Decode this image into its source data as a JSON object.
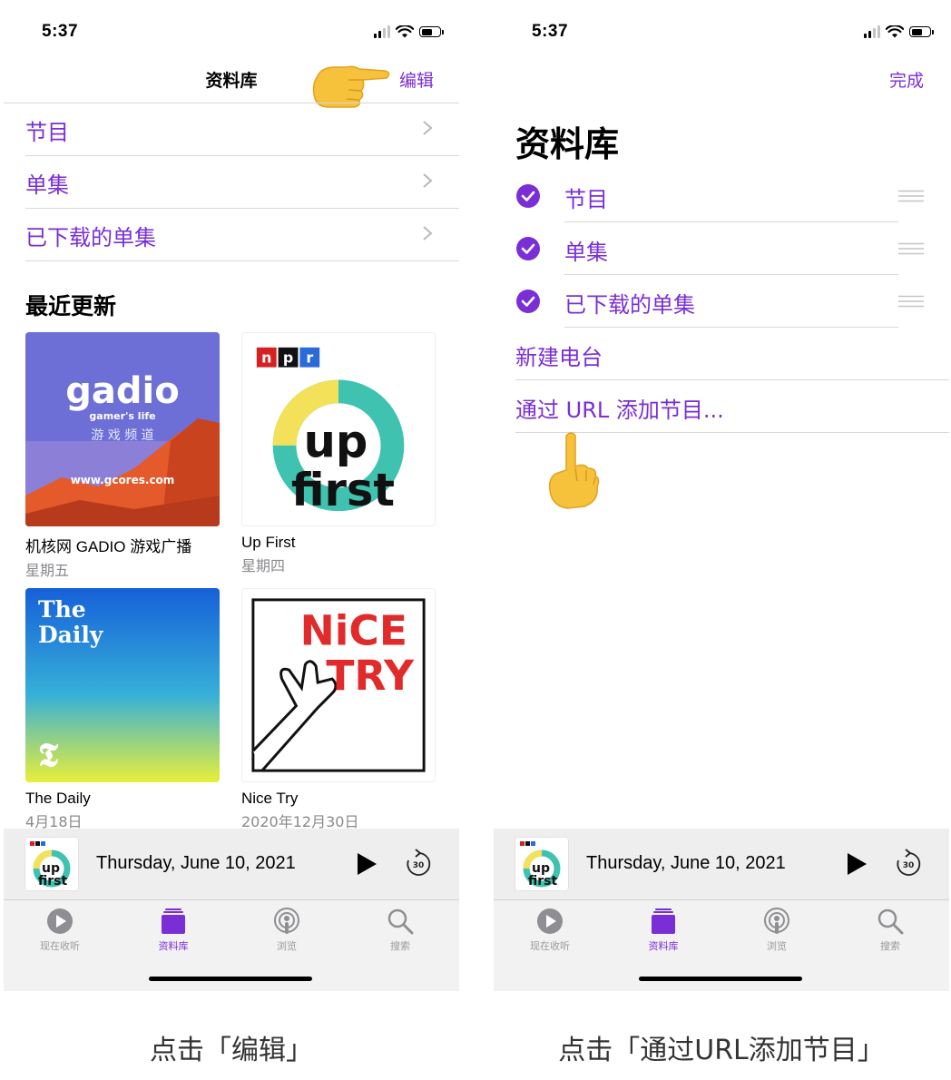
{
  "left": {
    "status": {
      "time": "5:37"
    },
    "nav": {
      "title": "资料库",
      "edit_label": "编辑"
    },
    "library_items": [
      {
        "label": "节目"
      },
      {
        "label": "单集"
      },
      {
        "label": "已下载的单集"
      }
    ],
    "recent": {
      "title": "最近更新",
      "tiles": [
        {
          "name": "机核网 GADIO 游戏广播",
          "date": "星期五",
          "art_text": [
            "gadio",
            "gamer's life",
            "游 戏 频 道",
            "www.gcores.com"
          ]
        },
        {
          "name": "Up First",
          "date": "星期四",
          "art_text": [
            "n",
            "p",
            "r",
            "up",
            "first"
          ]
        },
        {
          "name": "The Daily",
          "date": "4月18日",
          "art_text": [
            "The",
            "Daily"
          ]
        },
        {
          "name": "Nice Try",
          "date": "2020年12月30日",
          "art_text": [
            "NiCE",
            "TRY"
          ]
        }
      ]
    },
    "mini_player": {
      "episode": "Thursday, June 10, 2021",
      "skip_label": "30",
      "thumb_text": [
        "up",
        "first"
      ]
    },
    "tabs": [
      {
        "label": "现在收听",
        "icon": "play-circle-icon"
      },
      {
        "label": "资料库",
        "icon": "library-stack-icon",
        "active": true
      },
      {
        "label": "浏览",
        "icon": "podcast-icon"
      },
      {
        "label": "搜索",
        "icon": "search-icon"
      }
    ],
    "caption": "点击「编辑」"
  },
  "right": {
    "status": {
      "time": "5:37"
    },
    "nav": {
      "done_label": "完成"
    },
    "title": "资料库",
    "edit_items": [
      {
        "label": "节目",
        "checked": true
      },
      {
        "label": "单集",
        "checked": true
      },
      {
        "label": "已下载的单集",
        "checked": true
      }
    ],
    "extra_items": [
      {
        "label": "新建电台"
      },
      {
        "label": "通过 URL 添加节目..."
      }
    ],
    "mini_player": {
      "episode": "Thursday, June 10, 2021",
      "skip_label": "30",
      "thumb_text": [
        "up",
        "first"
      ]
    },
    "tabs": [
      {
        "label": "现在收听",
        "icon": "play-circle-icon"
      },
      {
        "label": "资料库",
        "icon": "library-stack-icon",
        "active": true
      },
      {
        "label": "浏览",
        "icon": "podcast-icon"
      },
      {
        "label": "搜索",
        "icon": "search-icon"
      }
    ],
    "caption": "点击「通过URL添加节目」"
  },
  "colors": {
    "accent": "#7a2fd6",
    "separator": "#d8d8d8",
    "secondary_text": "#8a8a8e"
  }
}
